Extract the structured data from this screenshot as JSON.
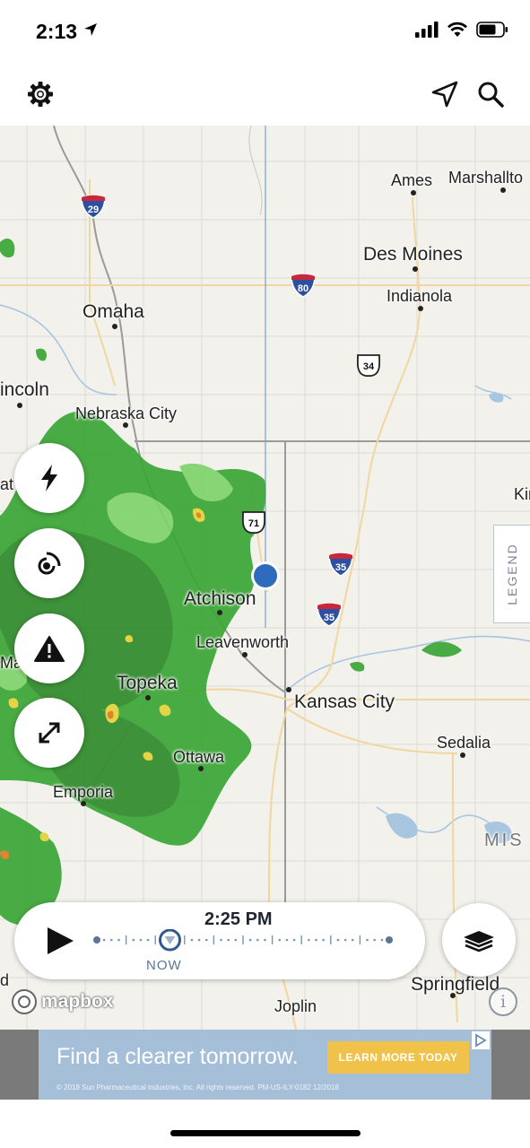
{
  "status_bar": {
    "time": "2:13"
  },
  "toolbar": {
    "settings_icon": "gear-icon",
    "location_icon": "navigation-arrow-icon",
    "search_icon": "magnifier-icon"
  },
  "map": {
    "places": [
      {
        "name": "Ames"
      },
      {
        "name": "Marshallto"
      },
      {
        "name": "Des Moines"
      },
      {
        "name": "Indianola"
      },
      {
        "name": "Omaha"
      },
      {
        "name": "incoln"
      },
      {
        "name": "Nebraska City"
      },
      {
        "name": "Atchison"
      },
      {
        "name": "Leavenworth"
      },
      {
        "name": "Topeka"
      },
      {
        "name": "Kansas City"
      },
      {
        "name": "Sedalia"
      },
      {
        "name": "Ottawa"
      },
      {
        "name": "Emporia"
      },
      {
        "name": "Springfield"
      },
      {
        "name": "Joplin"
      },
      {
        "name": "Kir"
      },
      {
        "name": "at"
      },
      {
        "name": "Ma"
      },
      {
        "name": "d"
      },
      {
        "name": "MIS"
      }
    ],
    "shields": [
      {
        "type": "interstate",
        "number": "29"
      },
      {
        "type": "interstate",
        "number": "80"
      },
      {
        "type": "us",
        "number": "34"
      },
      {
        "type": "us",
        "number": "71"
      },
      {
        "type": "interstate",
        "number": "35"
      },
      {
        "type": "interstate",
        "number": "35"
      }
    ]
  },
  "side_buttons": [
    {
      "icon": "lightning-icon"
    },
    {
      "icon": "radar-signal-icon"
    },
    {
      "icon": "warning-icon"
    },
    {
      "icon": "expand-icon"
    }
  ],
  "legend": {
    "label": "LEGEND"
  },
  "timeline": {
    "time": "2:25 PM",
    "now_label": "NOW",
    "total_ticks": 10,
    "current_position": 0.25
  },
  "layers": {
    "icon": "layers-icon"
  },
  "attribution": {
    "brand": "mapbox",
    "info": "i"
  },
  "ad": {
    "headline": "Find a clearer tomorrow.",
    "cta": "LEARN MORE TODAY",
    "fine_print": "© 2018 Sun Pharmaceutical Industries, Inc. All rights reserved. PM-US-ILY-0182 12/2018"
  },
  "colors": {
    "radar_green": "#3aa635",
    "radar_light_green": "#7fd36a",
    "radar_yellow": "#e6d23a",
    "radar_orange": "#e07b22",
    "location_dot": "#2f6bbd",
    "map_background": "#f2f1ec",
    "ad_background": "#a6bfd8",
    "ad_cta": "#f0c24a"
  }
}
